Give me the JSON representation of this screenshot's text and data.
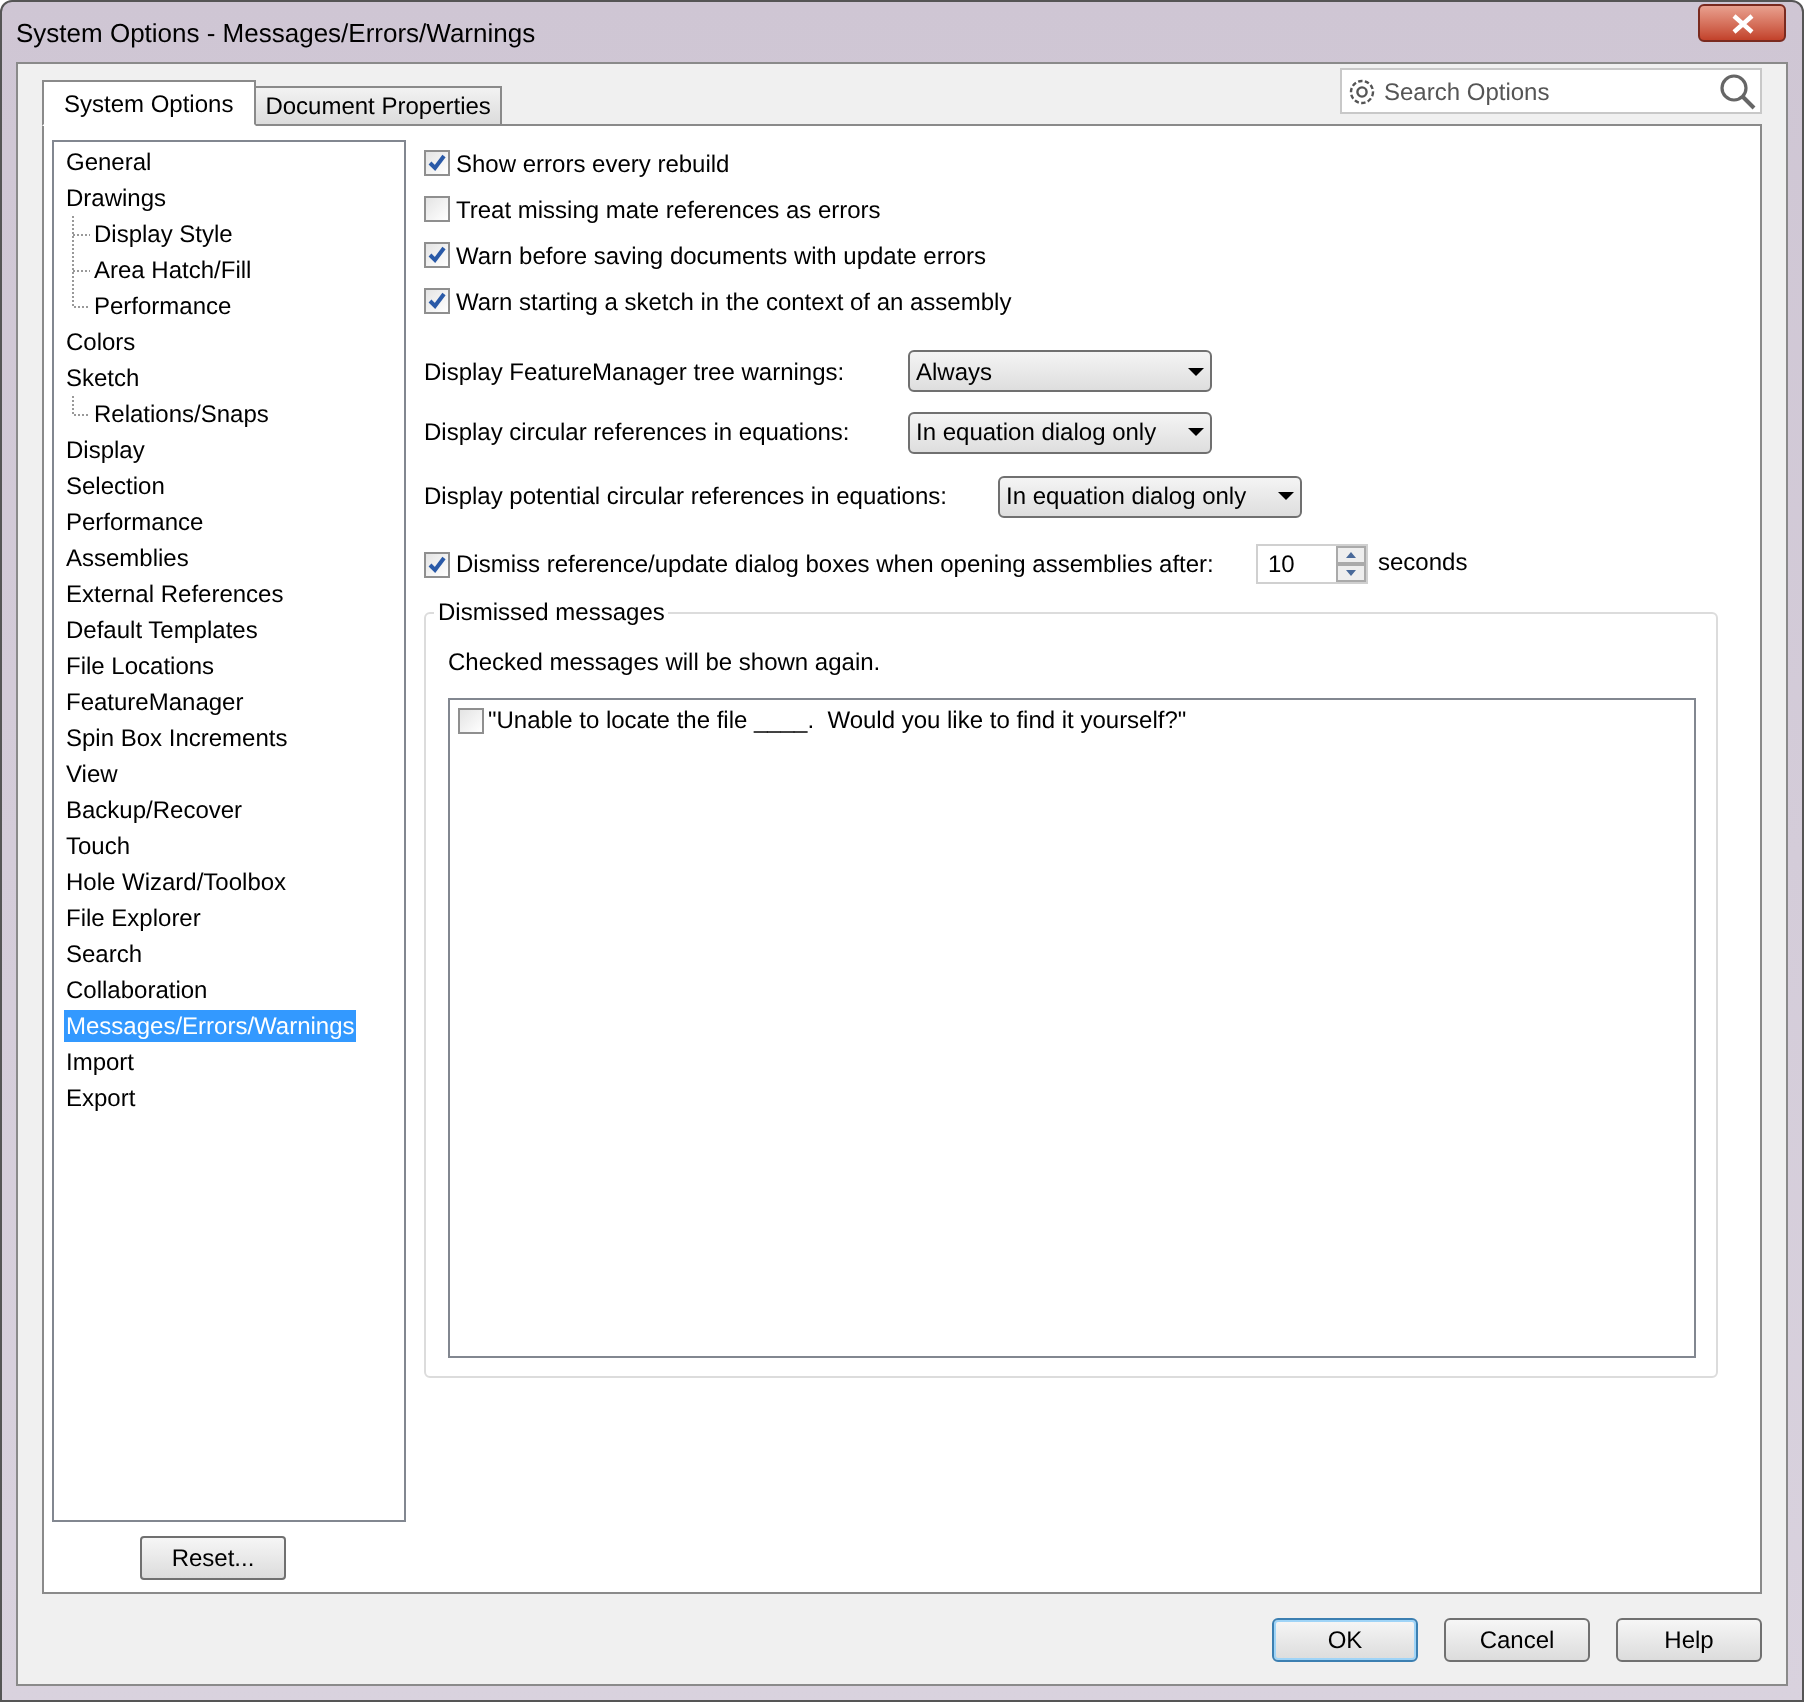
{
  "window": {
    "title": "System Options - Messages/Errors/Warnings"
  },
  "tabs": [
    {
      "label": "System Options",
      "selected": true
    },
    {
      "label": "Document Properties",
      "selected": false
    }
  ],
  "search": {
    "placeholder": "Search Options"
  },
  "sidebar": {
    "items": [
      {
        "label": "General",
        "selected": false
      },
      {
        "label": "Drawings",
        "selected": false,
        "children": [
          {
            "label": "Display Style",
            "selected": false
          },
          {
            "label": "Area Hatch/Fill",
            "selected": false
          },
          {
            "label": "Performance",
            "selected": false
          }
        ]
      },
      {
        "label": "Colors",
        "selected": false
      },
      {
        "label": "Sketch",
        "selected": false,
        "children": [
          {
            "label": "Relations/Snaps",
            "selected": false
          }
        ]
      },
      {
        "label": "Display",
        "selected": false
      },
      {
        "label": "Selection",
        "selected": false
      },
      {
        "label": "Performance",
        "selected": false
      },
      {
        "label": "Assemblies",
        "selected": false
      },
      {
        "label": "External References",
        "selected": false
      },
      {
        "label": "Default Templates",
        "selected": false
      },
      {
        "label": "File Locations",
        "selected": false
      },
      {
        "label": "FeatureManager",
        "selected": false
      },
      {
        "label": "Spin Box Increments",
        "selected": false
      },
      {
        "label": "View",
        "selected": false
      },
      {
        "label": "Backup/Recover",
        "selected": false
      },
      {
        "label": "Touch",
        "selected": false
      },
      {
        "label": "Hole Wizard/Toolbox",
        "selected": false
      },
      {
        "label": "File Explorer",
        "selected": false
      },
      {
        "label": "Search",
        "selected": false
      },
      {
        "label": "Collaboration",
        "selected": false
      },
      {
        "label": "Messages/Errors/Warnings",
        "selected": true
      },
      {
        "label": "Import",
        "selected": false
      },
      {
        "label": "Export",
        "selected": false
      }
    ]
  },
  "reset_button": "Reset...",
  "options": [
    {
      "label": "Show errors every rebuild",
      "checked": true
    },
    {
      "label": "Treat missing mate references as errors",
      "checked": false
    },
    {
      "label": "Warn before saving documents with update errors",
      "checked": true
    },
    {
      "label": "Warn starting a sketch in the context of an assembly",
      "checked": true
    }
  ],
  "dropdowns": [
    {
      "label": "Display FeatureManager tree warnings:",
      "value": "Always"
    },
    {
      "label": "Display circular references in equations:",
      "value": "In equation dialog only"
    },
    {
      "label": "Display potential circular references in equations:",
      "value": "In equation dialog only"
    }
  ],
  "dismiss": {
    "label": "Dismiss reference/update dialog boxes when opening assemblies after:",
    "checked": true,
    "value": "10",
    "unit": "seconds"
  },
  "dismissed_messages": {
    "title": "Dismissed messages",
    "hint": "Checked messages will be shown again.",
    "items": [
      {
        "label": "\"Unable to locate the file ____.  Would you like to find it yourself?\"",
        "checked": false
      }
    ]
  },
  "buttons": [
    "OK",
    "Cancel",
    "Help"
  ]
}
